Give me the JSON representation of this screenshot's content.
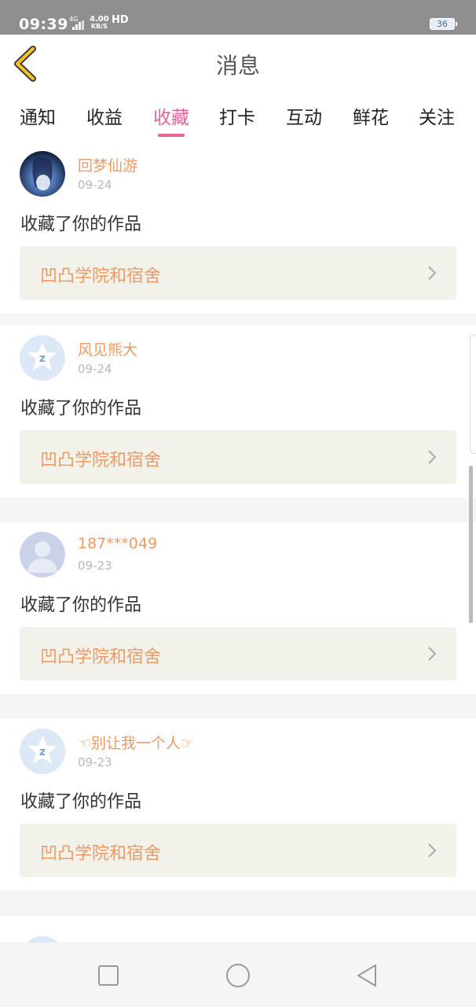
{
  "status_bar": {
    "time": "09:39",
    "network": "4G",
    "speed_value": "4.00",
    "speed_unit": "KB/S",
    "hd": "HD",
    "battery": "36"
  },
  "header": {
    "title": "消息"
  },
  "tabs": [
    {
      "label": "通知",
      "active": false
    },
    {
      "label": "收益",
      "active": false
    },
    {
      "label": "收藏",
      "active": true
    },
    {
      "label": "打卡",
      "active": false
    },
    {
      "label": "互动",
      "active": false
    },
    {
      "label": "鲜花",
      "active": false
    },
    {
      "label": "关注",
      "active": false
    }
  ],
  "messages": [
    {
      "user": "回梦仙游",
      "date": "09-24",
      "action": "收藏了你的作品",
      "work": "凹凸学院和宿舍",
      "avatar": "anime-avatar"
    },
    {
      "user": "风见熊大",
      "date": "09-24",
      "action": "收藏了你的作品",
      "work": "凹凸学院和宿舍",
      "avatar": "qq-star-avatar"
    },
    {
      "user": "187***049",
      "date": "09-23",
      "action": "收藏了你的作品",
      "work": "凹凸学院和宿舍",
      "avatar": "default-person-avatar"
    },
    {
      "user": "☜别让我一个人☞",
      "date": "09-23",
      "action": "收藏了你的作品",
      "work": "凹凸学院和宿舍",
      "avatar": "qq-star-avatar"
    }
  ],
  "colors": {
    "accent": "#e8639a",
    "username": "#f09a61",
    "back_arrow": "#f3c12c",
    "status_bar_bg": "#8f8f8f"
  }
}
